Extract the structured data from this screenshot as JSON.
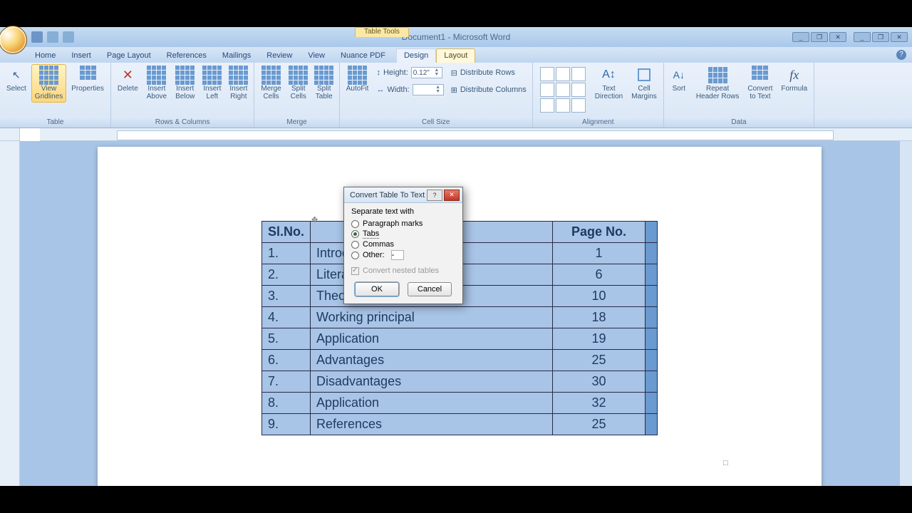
{
  "titlebar": {
    "doc_title": "Document1 - Microsoft Word",
    "context_caption": "Table Tools"
  },
  "win_controls": {
    "min": "_",
    "max": "❐",
    "close": "✕",
    "doc_min": "_",
    "doc_max": "❐",
    "doc_close": "✕"
  },
  "tabs": {
    "home": "Home",
    "insert": "Insert",
    "page_layout": "Page Layout",
    "references": "References",
    "mailings": "Mailings",
    "review": "Review",
    "view": "View",
    "nuance": "Nuance PDF",
    "design": "Design",
    "layout": "Layout"
  },
  "ribbon": {
    "table": {
      "label": "Table",
      "select": "Select",
      "view_gridlines": "View\nGridlines",
      "properties": "Properties"
    },
    "rows_cols": {
      "label": "Rows & Columns",
      "delete": "Delete",
      "insert_above": "Insert\nAbove",
      "insert_below": "Insert\nBelow",
      "insert_left": "Insert\nLeft",
      "insert_right": "Insert\nRight"
    },
    "merge": {
      "label": "Merge",
      "merge_cells": "Merge\nCells",
      "split_cells": "Split\nCells",
      "split_table": "Split\nTable"
    },
    "cell_size": {
      "label": "Cell Size",
      "autofit": "AutoFit",
      "height": "Height:",
      "height_val": "0.12\"",
      "width": "Width:",
      "width_val": "",
      "dist_rows": "Distribute Rows",
      "dist_cols": "Distribute Columns"
    },
    "alignment": {
      "label": "Alignment",
      "text_direction": "Text\nDirection",
      "cell_margins": "Cell\nMargins"
    },
    "data": {
      "label": "Data",
      "sort": "Sort",
      "repeat_header": "Repeat\nHeader Rows",
      "convert_text": "Convert\nto Text",
      "formula": "Formula"
    }
  },
  "doc_table": {
    "headers": {
      "sl": "Sl.No.",
      "topic": "",
      "page": "Page No."
    },
    "rows": [
      {
        "sl": "1.",
        "topic": "Introduction",
        "page": "1"
      },
      {
        "sl": "2.",
        "topic": "Literature",
        "page": "6"
      },
      {
        "sl": "3.",
        "topic": "Theoretical",
        "page": "10"
      },
      {
        "sl": "4.",
        "topic": "Working principal",
        "page": "18"
      },
      {
        "sl": "5.",
        "topic": "Application",
        "page": "19"
      },
      {
        "sl": "6.",
        "topic": "Advantages",
        "page": "25"
      },
      {
        "sl": "7.",
        "topic": "Disadvantages",
        "page": "30"
      },
      {
        "sl": "8.",
        "topic": "Application",
        "page": "32"
      },
      {
        "sl": "9.",
        "topic": "References",
        "page": "25"
      }
    ]
  },
  "dialog": {
    "title": "Convert Table To Text",
    "group": "Separate text with",
    "opt_para": "Paragraph marks",
    "opt_tabs": "Tabs",
    "opt_commas": "Commas",
    "opt_other": "Other:",
    "chk_nested": "Convert nested tables",
    "ok": "OK",
    "cancel": "Cancel"
  }
}
